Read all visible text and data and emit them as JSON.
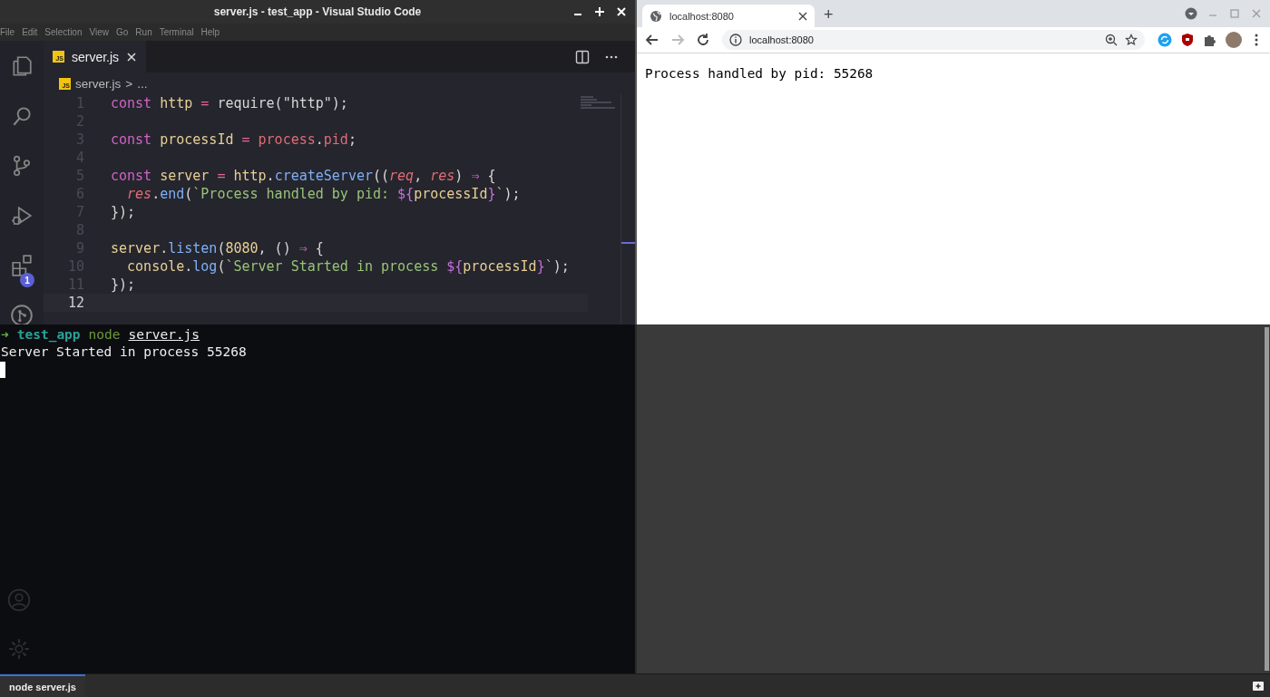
{
  "editor_window": {
    "title": "server.js - test_app - Visual Studio Code",
    "menu": [
      "File",
      "Edit",
      "Selection",
      "View",
      "Go",
      "Run",
      "Terminal",
      "Help"
    ],
    "activity_bar": [
      {
        "kind": "files"
      },
      {
        "kind": "search"
      },
      {
        "kind": "source-control"
      },
      {
        "kind": "debug"
      },
      {
        "kind": "extensions",
        "badge": "1"
      },
      {
        "kind": "git"
      }
    ],
    "tabs": [
      {
        "icon_label": "JS",
        "label": "server.js",
        "selected": true
      }
    ],
    "breadcrumb": {
      "icon_label": "JS",
      "file": "server.js",
      "separator": ">",
      "rest": "..."
    },
    "lines": [
      {
        "number": "1",
        "current": false,
        "tokens": [
          {
            "t": "const",
            "kind": "kw"
          },
          {
            "t": " http",
            "kind": "var"
          },
          {
            "t": " =",
            "kind": "op"
          },
          {
            "t": " require(\"http\");"
          }
        ]
      },
      {
        "number": "2",
        "current": false
      },
      {
        "number": "3",
        "current": false,
        "tokens": [
          {
            "t": "const",
            "kind": "kw"
          },
          {
            "t": " processId",
            "kind": "var"
          },
          {
            "t": " =",
            "kind": "op"
          },
          {
            "t": " process",
            "kind": "prop"
          },
          {
            "t": "."
          },
          {
            "t": "pid",
            "kind": "prop"
          },
          {
            "t": ";"
          }
        ]
      },
      {
        "number": "4",
        "current": false
      },
      {
        "number": "5",
        "current": false,
        "tokens": [
          {
            "t": "const",
            "kind": "kw"
          },
          {
            "t": " server",
            "kind": "var"
          },
          {
            "t": " =",
            "kind": "op"
          },
          {
            "t": " http",
            "kind": "var"
          },
          {
            "t": "."
          },
          {
            "t": "createServer",
            "kind": "fn"
          },
          {
            "t": "(("
          },
          {
            "t": "req",
            "kind": "param"
          },
          {
            "t": ", "
          },
          {
            "t": "res",
            "kind": "param"
          },
          {
            "t": ") "
          },
          {
            "t": "⇒",
            "kind": "kw"
          },
          {
            "t": " {"
          }
        ]
      },
      {
        "number": "6",
        "current": false,
        "tokens": [
          {
            "t": "  res",
            "kind": "param"
          },
          {
            "t": "."
          },
          {
            "t": "end",
            "kind": "fn"
          },
          {
            "t": "("
          },
          {
            "t": "`Process handled by pid: ",
            "kind": "str"
          },
          {
            "t": "${",
            "kind": "interp"
          },
          {
            "t": "processId",
            "kind": "var"
          },
          {
            "t": "}",
            "kind": "interp"
          },
          {
            "t": "`",
            "kind": "str"
          },
          {
            "t": ");"
          }
        ]
      },
      {
        "number": "7",
        "current": false,
        "tokens": [
          {
            "t": "});"
          }
        ]
      },
      {
        "number": "8",
        "current": false
      },
      {
        "number": "9",
        "current": false,
        "tokens": [
          {
            "t": "server",
            "kind": "var"
          },
          {
            "t": "."
          },
          {
            "t": "listen",
            "kind": "fn"
          },
          {
            "t": "("
          },
          {
            "t": "8080",
            "kind": "num"
          },
          {
            "t": ", () "
          },
          {
            "t": "⇒",
            "kind": "kw"
          },
          {
            "t": " {"
          }
        ]
      },
      {
        "number": "10",
        "current": false,
        "tokens": [
          {
            "t": "  console",
            "kind": "var"
          },
          {
            "t": "."
          },
          {
            "t": "log",
            "kind": "fn"
          },
          {
            "t": "("
          },
          {
            "t": "`Server Started in process ",
            "kind": "str"
          },
          {
            "t": "${",
            "kind": "interp"
          },
          {
            "t": "processId",
            "kind": "var"
          },
          {
            "t": "}",
            "kind": "interp"
          },
          {
            "t": "`",
            "kind": "str"
          },
          {
            "t": ");"
          }
        ]
      },
      {
        "number": "11",
        "current": false,
        "tokens": [
          {
            "t": "});"
          }
        ]
      },
      {
        "number": "12",
        "current": true
      }
    ]
  },
  "browser": {
    "tabs": [
      {
        "title": "localhost:8080",
        "selected": true
      }
    ],
    "new_tab": "+",
    "nav": [
      {
        "kind": "back",
        "disabled": false
      },
      {
        "kind": "forward",
        "disabled": true
      },
      {
        "kind": "reload",
        "disabled": false
      }
    ],
    "address": "localhost:8080",
    "page_text": "Process handled by pid: 55268"
  },
  "terminal": {
    "lines": [
      [
        {
          "t": "➜",
          "kind": "arrow"
        },
        {
          "t": "test_app",
          "kind": "dir"
        },
        {
          "t": "node",
          "kind": "cmd"
        },
        {
          "t": "server.js",
          "kind": "arg"
        }
      ],
      [
        {
          "t": "Server Started in process 55268",
          "kind": "out"
        }
      ]
    ],
    "cursor": true
  },
  "panel_bar": {
    "tabs": [
      {
        "label": "node server.js",
        "selected": true
      }
    ]
  }
}
